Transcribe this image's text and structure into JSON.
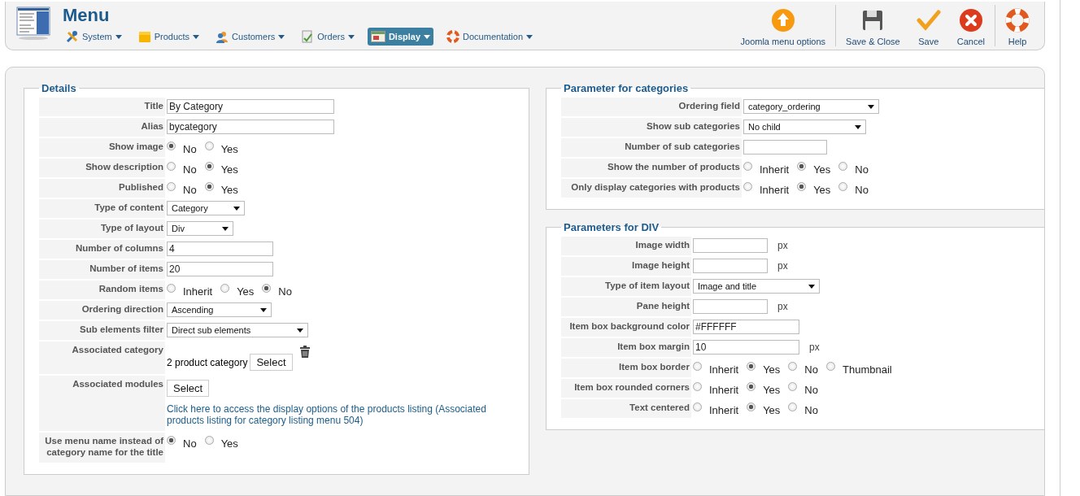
{
  "header": {
    "title": "Menu",
    "menu": [
      {
        "label": "System",
        "kind": "tools",
        "selected": false
      },
      {
        "label": "Products",
        "kind": "box",
        "selected": false
      },
      {
        "label": "Customers",
        "kind": "people",
        "selected": false
      },
      {
        "label": "Orders",
        "kind": "doc",
        "selected": false
      },
      {
        "label": "Display",
        "kind": "screen",
        "selected": true
      },
      {
        "label": "Documentation",
        "kind": "buoy",
        "selected": false
      }
    ],
    "toolbar": [
      {
        "label": "Joomla menu options",
        "kind": "up"
      },
      {
        "label": "Save & Close",
        "kind": "floppy"
      },
      {
        "label": "Save",
        "kind": "check"
      },
      {
        "label": "Cancel",
        "kind": "cancel"
      },
      {
        "label": "Help",
        "kind": "buoy"
      }
    ]
  },
  "left_column": [
    {
      "legend": "Details",
      "fields": [
        {
          "label": "Title",
          "kind": "text",
          "value": "By Category"
        },
        {
          "label": "Alias",
          "kind": "text",
          "value": "bycategory"
        },
        {
          "label": "Show image",
          "kind": "radio",
          "options": [
            {
              "label": "No",
              "selected": true
            },
            {
              "label": "Yes",
              "selected": false
            }
          ]
        },
        {
          "label": "Show description",
          "kind": "radio",
          "options": [
            {
              "label": "No",
              "selected": false
            },
            {
              "label": "Yes",
              "selected": true
            }
          ]
        },
        {
          "label": "Published",
          "kind": "radio",
          "options": [
            {
              "label": "No",
              "selected": false
            },
            {
              "label": "Yes",
              "selected": true
            }
          ]
        },
        {
          "label": "Type of content",
          "kind": "select",
          "value": "Category"
        },
        {
          "label": "Type of layout",
          "kind": "select",
          "value": "Div"
        },
        {
          "label": "Number of columns",
          "kind": "text",
          "value": "4"
        },
        {
          "label": "Number of items",
          "kind": "text",
          "value": "20"
        },
        {
          "label": "Random items",
          "kind": "radio",
          "options": [
            {
              "label": "Inherit",
              "selected": false
            },
            {
              "label": "Yes",
              "selected": false
            },
            {
              "label": "No",
              "selected": true
            }
          ]
        },
        {
          "label": "Ordering direction",
          "kind": "select",
          "value": "Ascending"
        },
        {
          "label": "Sub elements filter",
          "kind": "select",
          "value": "Direct sub elements"
        },
        {
          "label": "Associated category",
          "kind": "category",
          "value": "2 product category",
          "button": "Select"
        },
        {
          "label": "Associated modules",
          "kind": "modules",
          "button": "Select",
          "link": "Click here to access the display options of the products listing (Associated products listing for category listing menu 504)"
        },
        {
          "label": "Use menu name instead of category name for the title",
          "kind": "radio",
          "options": [
            {
              "label": "No",
              "selected": true
            },
            {
              "label": "Yes",
              "selected": false
            }
          ]
        }
      ]
    }
  ],
  "right_column": [
    {
      "legend": "Parameter for categories",
      "fields": [
        {
          "label": "Ordering field",
          "kind": "select",
          "value": "category_ordering"
        },
        {
          "label": "Show sub categories",
          "kind": "select",
          "value": "No child"
        },
        {
          "label": "Number of sub categories",
          "kind": "text"
        },
        {
          "label": "Show the number of products",
          "kind": "radio",
          "options": [
            {
              "label": "Inherit",
              "selected": false
            },
            {
              "label": "Yes",
              "selected": true
            },
            {
              "label": "No",
              "selected": false
            }
          ]
        },
        {
          "label": "Only display categories with products",
          "kind": "radio",
          "options": [
            {
              "label": "Inherit",
              "selected": false
            },
            {
              "label": "Yes",
              "selected": true
            },
            {
              "label": "No",
              "selected": false
            }
          ]
        }
      ]
    },
    {
      "legend": "Parameters for DIV",
      "fields": [
        {
          "label": "Image width",
          "kind": "text",
          "unit": "px"
        },
        {
          "label": "Image height",
          "kind": "text",
          "unit": "px"
        },
        {
          "label": "Type of item layout",
          "kind": "select",
          "value": "Image and title"
        },
        {
          "label": "Pane height",
          "kind": "text",
          "unit": "px"
        },
        {
          "label": "Item box background color",
          "kind": "text",
          "value": "#FFFFFF"
        },
        {
          "label": "Item box margin",
          "kind": "text",
          "value": "10",
          "unit": "px"
        },
        {
          "label": "Item box border",
          "kind": "radio",
          "options": [
            {
              "label": "Inherit",
              "selected": false
            },
            {
              "label": "Yes",
              "selected": true
            },
            {
              "label": "No",
              "selected": false
            },
            {
              "label": "Thumbnail",
              "selected": false
            }
          ]
        },
        {
          "label": "Item box rounded corners",
          "kind": "radio",
          "options": [
            {
              "label": "Inherit",
              "selected": false
            },
            {
              "label": "Yes",
              "selected": true
            },
            {
              "label": "No",
              "selected": false
            }
          ]
        },
        {
          "label": "Text centered",
          "kind": "radio",
          "options": [
            {
              "label": "Inherit",
              "selected": false
            },
            {
              "label": "Yes",
              "selected": true
            },
            {
              "label": "No",
              "selected": false
            }
          ]
        }
      ]
    }
  ]
}
